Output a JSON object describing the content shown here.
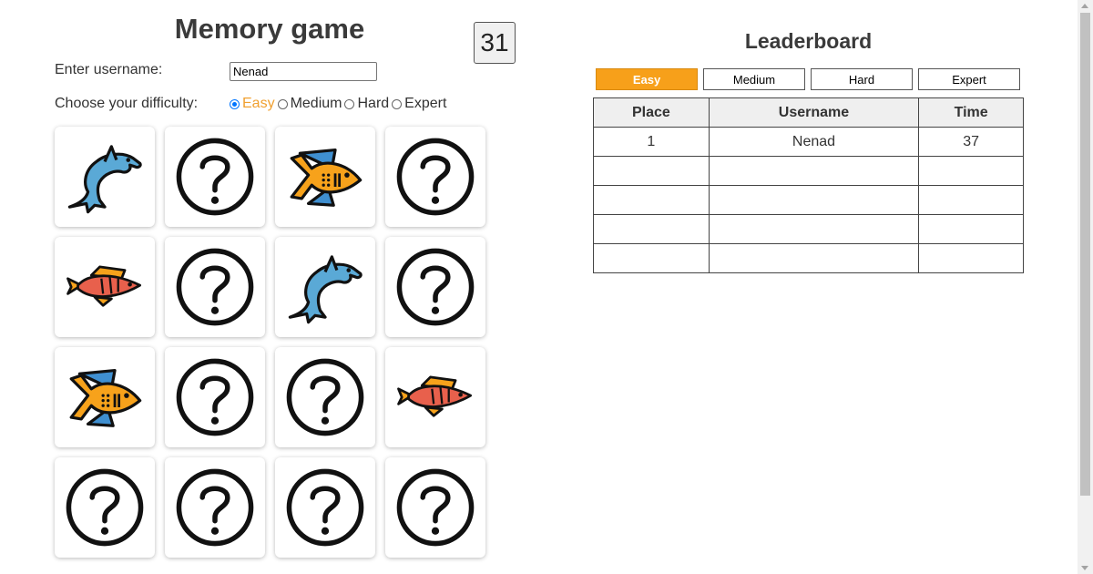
{
  "game": {
    "title": "Memory game",
    "timer": "31",
    "username_label": "Enter username:",
    "username_value": "Nenad",
    "difficulty_label": "Choose your difficulty:",
    "difficulty_options": [
      "Easy",
      "Medium",
      "Hard",
      "Expert"
    ],
    "difficulty_selected": "Easy",
    "cards": [
      {
        "face": "dolphin-icon"
      },
      {
        "face": "question-icon"
      },
      {
        "face": "yellow-fish-icon"
      },
      {
        "face": "question-icon"
      },
      {
        "face": "red-fish-icon"
      },
      {
        "face": "question-icon"
      },
      {
        "face": "dolphin-icon"
      },
      {
        "face": "question-icon"
      },
      {
        "face": "yellow-fish-icon"
      },
      {
        "face": "question-icon"
      },
      {
        "face": "question-icon"
      },
      {
        "face": "red-fish-icon"
      },
      {
        "face": "question-icon"
      },
      {
        "face": "question-icon"
      },
      {
        "face": "question-icon"
      },
      {
        "face": "question-icon"
      }
    ]
  },
  "leaderboard": {
    "title": "Leaderboard",
    "tabs": [
      "Easy",
      "Medium",
      "Hard",
      "Expert"
    ],
    "active_tab": "Easy",
    "columns": [
      "Place",
      "Username",
      "Time"
    ],
    "rows": [
      [
        "1",
        "Nenad",
        "37"
      ],
      [
        "",
        "",
        ""
      ],
      [
        "",
        "",
        ""
      ],
      [
        "",
        "",
        ""
      ],
      [
        "",
        "",
        ""
      ]
    ]
  },
  "colors": {
    "accent": "#f7a01a",
    "radio_checked": "#0075ff",
    "dolphin": "#5aa9d6",
    "yellow_fish": "#f7a21b",
    "yellow_fish_fin": "#3f8fd0",
    "red_fish": "#e8604c",
    "red_fish_fin": "#f7a21b"
  }
}
